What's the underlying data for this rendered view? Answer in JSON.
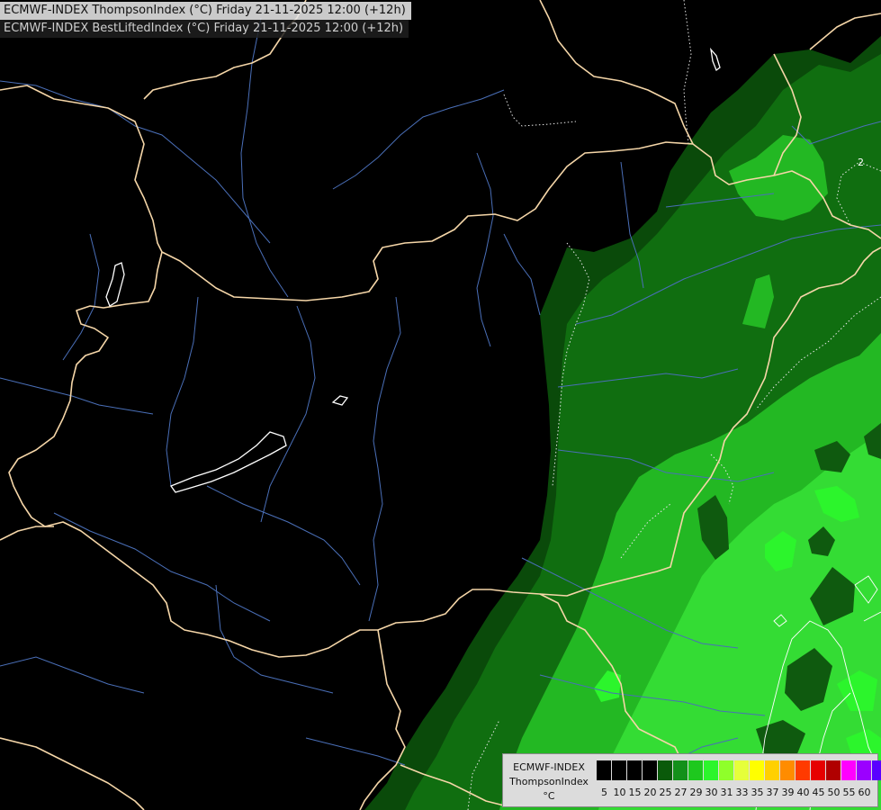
{
  "header": {
    "title_primary": "ECMWF-INDEX ThompsonIndex (°C) Friday 21-11-2025 12:00 (+12h)",
    "title_secondary": "ECMWF-INDEX BestLiftedIndex (°C) Friday 21-11-2025 12:00 (+12h)"
  },
  "map": {
    "contour_labels": [
      "2"
    ],
    "colors": {
      "background": "#000000",
      "borders": "#f5d6a8",
      "rivers": "#4a6fb8",
      "lakes": "#ffffff",
      "band_dark": "#0a4a0a",
      "band_mid": "#106e10",
      "band_bright": "#23b823",
      "band_light": "#34dc34",
      "band_neon": "#2cf52c"
    }
  },
  "legend": {
    "source": "ECMWF-INDEX",
    "parameter": "ThompsonIndex",
    "unit": "°C",
    "ticks": [
      "5",
      "10",
      "15",
      "20",
      "25",
      "27",
      "29",
      "30",
      "31",
      "33",
      "35",
      "37",
      "39",
      "40",
      "45",
      "50",
      "55",
      "60"
    ],
    "swatch_colors": [
      "#000000",
      "#000000",
      "#000000",
      "#000000",
      "#0a5a0a",
      "#13901a",
      "#1ec81e",
      "#2cf52c",
      "#8fff2a",
      "#e6ff3a",
      "#ffff00",
      "#ffd000",
      "#ff8c00",
      "#ff3a00",
      "#e60000",
      "#b00000",
      "#ff00ff",
      "#9b00ff",
      "#5a00ff",
      "#0000ff"
    ]
  }
}
